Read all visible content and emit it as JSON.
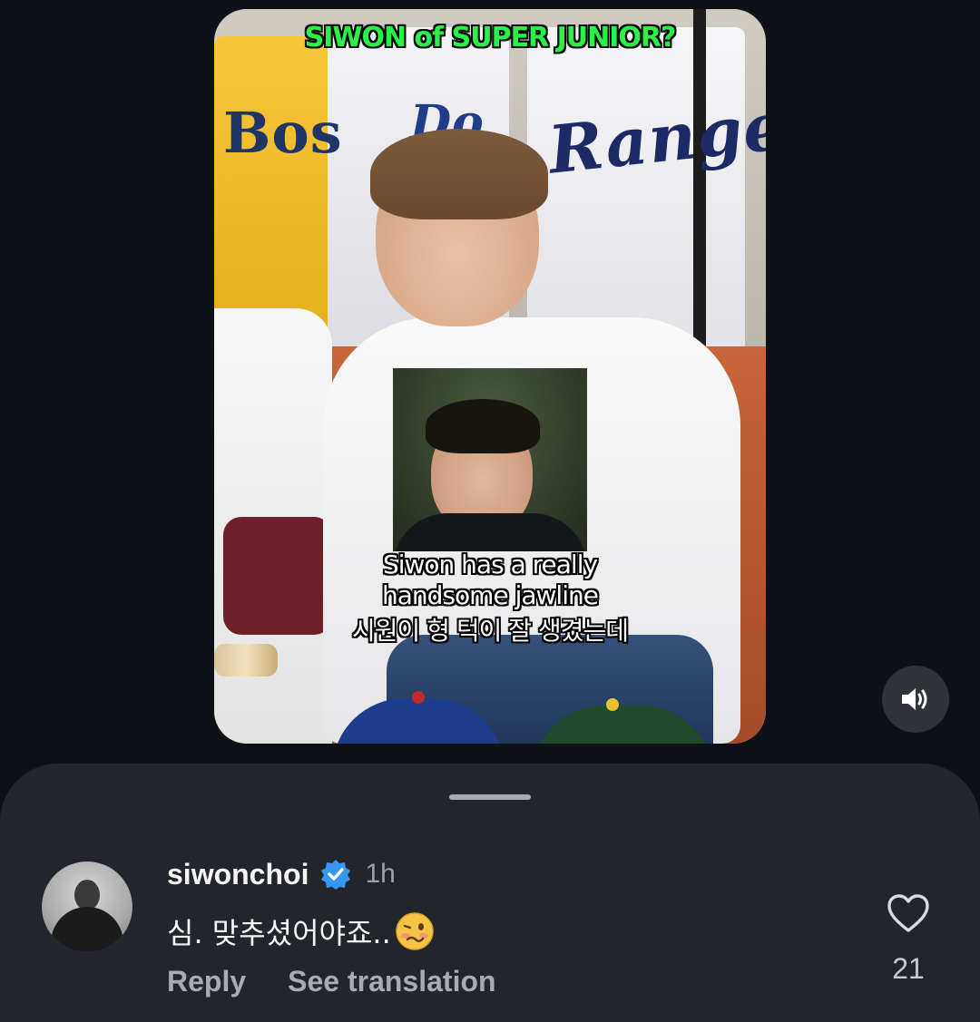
{
  "video": {
    "headline": "SIWON of SUPER JUNIOR?",
    "caption_lines": [
      "Siwon has a really",
      "handsome jawline",
      "시원이 형 턱이 잘 생겼는데"
    ],
    "sound_icon": "speaker-volume-icon"
  },
  "comments_sheet": {
    "comment": {
      "username": "siwonchoi",
      "verified": true,
      "time": "1h",
      "text": "심. 맞추셨어야죠..",
      "emoji": "woozy-face-emoji",
      "actions": {
        "reply_label": "Reply",
        "translate_label": "See translation"
      },
      "likes": "21",
      "like_icon": "heart-outline-icon"
    }
  },
  "colors": {
    "background": "#0d1116",
    "sheet": "#22252b",
    "verified_blue": "#3797f0",
    "headline_green": "#2cf04a"
  }
}
